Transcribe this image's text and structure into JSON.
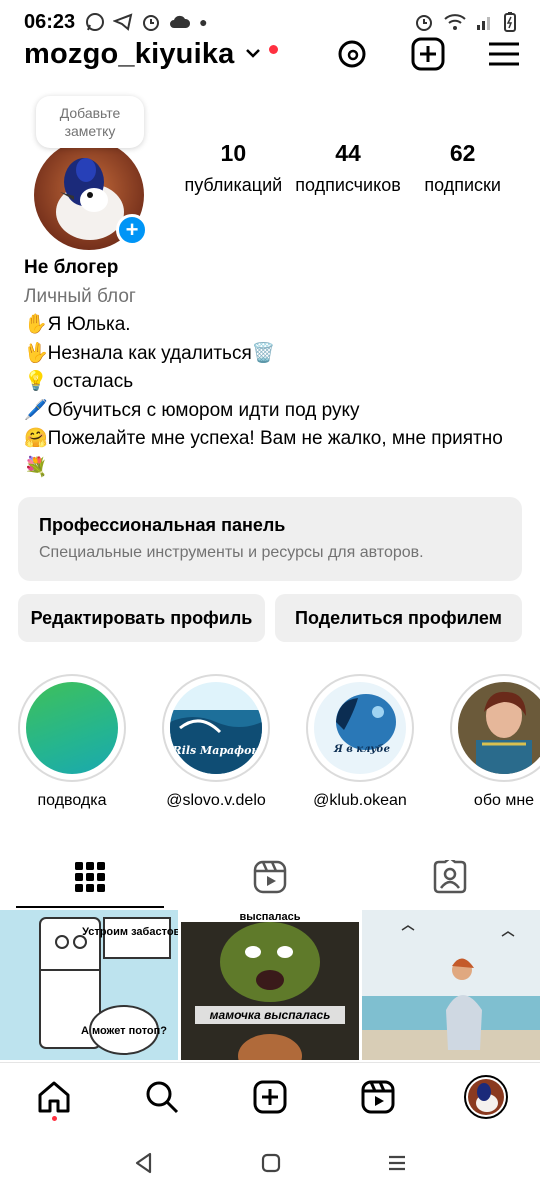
{
  "status_bar": {
    "time": "06:23"
  },
  "header": {
    "username": "mozgo_kiyuika"
  },
  "note": {
    "text": "Добавьте заметку"
  },
  "stats": [
    {
      "value": "10",
      "label": "публикаций"
    },
    {
      "value": "44",
      "label": "подписчиков"
    },
    {
      "value": "62",
      "label": "подписки"
    }
  ],
  "bio": {
    "name": "Не блогер",
    "category": "Личный блог",
    "lines": [
      "✋Я Юлька.",
      "🖖Незнала как удалиться🗑️",
      "💡 осталась",
      "🖊️Обучиться с юмором идти под руку",
      "🤗Пожелайте мне успеха! Вам не жалко, мне приятно 💐"
    ]
  },
  "pro_panel": {
    "title": "Профессиональная панель",
    "subtitle": "Специальные инструменты и ресурсы для авторов."
  },
  "buttons": {
    "edit": "Редактировать профиль",
    "share": "Поделиться профилем"
  },
  "highlights": [
    {
      "label": "подводка"
    },
    {
      "label": "@slovo.v.delo",
      "caption": "Rils Марафон"
    },
    {
      "label": "@klub.okean",
      "caption": "Я в клубе"
    },
    {
      "label": "обо мне"
    }
  ],
  "grid_posts": [
    {
      "text_1": "Устроим забастовку",
      "text_2": "А может потоп?"
    },
    {
      "text_top": "выспалась",
      "text_mid": "мамочка выспалась"
    },
    {}
  ],
  "colors": {
    "accent": "#0095f6",
    "notify": "#ff3040"
  }
}
